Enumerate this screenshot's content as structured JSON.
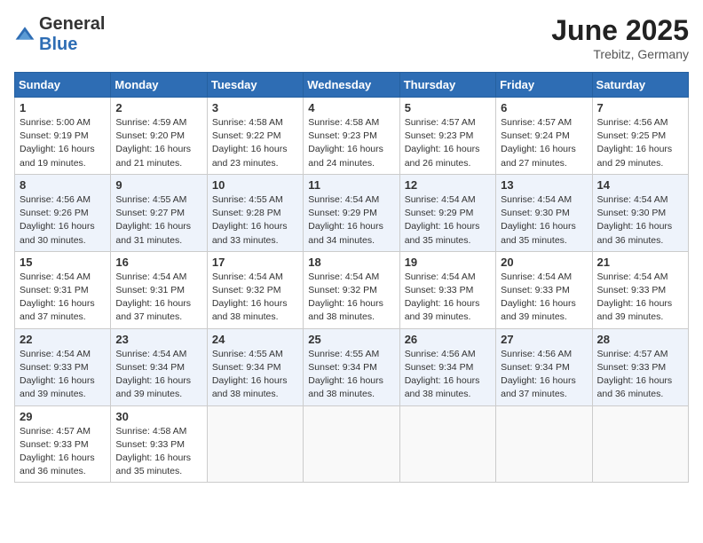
{
  "header": {
    "logo_general": "General",
    "logo_blue": "Blue",
    "title": "June 2025",
    "location": "Trebitz, Germany"
  },
  "columns": [
    "Sunday",
    "Monday",
    "Tuesday",
    "Wednesday",
    "Thursday",
    "Friday",
    "Saturday"
  ],
  "weeks": [
    [
      {
        "day": "1",
        "sunrise": "5:00 AM",
        "sunset": "9:19 PM",
        "daylight": "16 hours and 19 minutes."
      },
      {
        "day": "2",
        "sunrise": "4:59 AM",
        "sunset": "9:20 PM",
        "daylight": "16 hours and 21 minutes."
      },
      {
        "day": "3",
        "sunrise": "4:58 AM",
        "sunset": "9:22 PM",
        "daylight": "16 hours and 23 minutes."
      },
      {
        "day": "4",
        "sunrise": "4:58 AM",
        "sunset": "9:23 PM",
        "daylight": "16 hours and 24 minutes."
      },
      {
        "day": "5",
        "sunrise": "4:57 AM",
        "sunset": "9:23 PM",
        "daylight": "16 hours and 26 minutes."
      },
      {
        "day": "6",
        "sunrise": "4:57 AM",
        "sunset": "9:24 PM",
        "daylight": "16 hours and 27 minutes."
      },
      {
        "day": "7",
        "sunrise": "4:56 AM",
        "sunset": "9:25 PM",
        "daylight": "16 hours and 29 minutes."
      }
    ],
    [
      {
        "day": "8",
        "sunrise": "4:56 AM",
        "sunset": "9:26 PM",
        "daylight": "16 hours and 30 minutes."
      },
      {
        "day": "9",
        "sunrise": "4:55 AM",
        "sunset": "9:27 PM",
        "daylight": "16 hours and 31 minutes."
      },
      {
        "day": "10",
        "sunrise": "4:55 AM",
        "sunset": "9:28 PM",
        "daylight": "16 hours and 33 minutes."
      },
      {
        "day": "11",
        "sunrise": "4:54 AM",
        "sunset": "9:29 PM",
        "daylight": "16 hours and 34 minutes."
      },
      {
        "day": "12",
        "sunrise": "4:54 AM",
        "sunset": "9:29 PM",
        "daylight": "16 hours and 35 minutes."
      },
      {
        "day": "13",
        "sunrise": "4:54 AM",
        "sunset": "9:30 PM",
        "daylight": "16 hours and 35 minutes."
      },
      {
        "day": "14",
        "sunrise": "4:54 AM",
        "sunset": "9:30 PM",
        "daylight": "16 hours and 36 minutes."
      }
    ],
    [
      {
        "day": "15",
        "sunrise": "4:54 AM",
        "sunset": "9:31 PM",
        "daylight": "16 hours and 37 minutes."
      },
      {
        "day": "16",
        "sunrise": "4:54 AM",
        "sunset": "9:31 PM",
        "daylight": "16 hours and 37 minutes."
      },
      {
        "day": "17",
        "sunrise": "4:54 AM",
        "sunset": "9:32 PM",
        "daylight": "16 hours and 38 minutes."
      },
      {
        "day": "18",
        "sunrise": "4:54 AM",
        "sunset": "9:32 PM",
        "daylight": "16 hours and 38 minutes."
      },
      {
        "day": "19",
        "sunrise": "4:54 AM",
        "sunset": "9:33 PM",
        "daylight": "16 hours and 39 minutes."
      },
      {
        "day": "20",
        "sunrise": "4:54 AM",
        "sunset": "9:33 PM",
        "daylight": "16 hours and 39 minutes."
      },
      {
        "day": "21",
        "sunrise": "4:54 AM",
        "sunset": "9:33 PM",
        "daylight": "16 hours and 39 minutes."
      }
    ],
    [
      {
        "day": "22",
        "sunrise": "4:54 AM",
        "sunset": "9:33 PM",
        "daylight": "16 hours and 39 minutes."
      },
      {
        "day": "23",
        "sunrise": "4:54 AM",
        "sunset": "9:34 PM",
        "daylight": "16 hours and 39 minutes."
      },
      {
        "day": "24",
        "sunrise": "4:55 AM",
        "sunset": "9:34 PM",
        "daylight": "16 hours and 38 minutes."
      },
      {
        "day": "25",
        "sunrise": "4:55 AM",
        "sunset": "9:34 PM",
        "daylight": "16 hours and 38 minutes."
      },
      {
        "day": "26",
        "sunrise": "4:56 AM",
        "sunset": "9:34 PM",
        "daylight": "16 hours and 38 minutes."
      },
      {
        "day": "27",
        "sunrise": "4:56 AM",
        "sunset": "9:34 PM",
        "daylight": "16 hours and 37 minutes."
      },
      {
        "day": "28",
        "sunrise": "4:57 AM",
        "sunset": "9:33 PM",
        "daylight": "16 hours and 36 minutes."
      }
    ],
    [
      {
        "day": "29",
        "sunrise": "4:57 AM",
        "sunset": "9:33 PM",
        "daylight": "16 hours and 36 minutes."
      },
      {
        "day": "30",
        "sunrise": "4:58 AM",
        "sunset": "9:33 PM",
        "daylight": "16 hours and 35 minutes."
      },
      null,
      null,
      null,
      null,
      null
    ]
  ]
}
